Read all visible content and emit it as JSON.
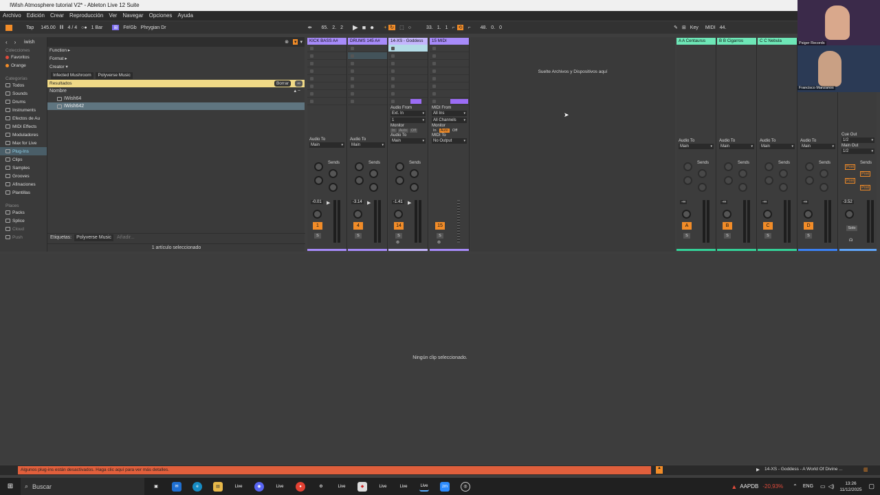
{
  "window": {
    "title": "IWish Atmosphere tutorial V2* - Ableton Live 12 Suite"
  },
  "menu": [
    "Archivo",
    "Edición",
    "Crear",
    "Reproducción",
    "Ver",
    "Navegar",
    "Opciones",
    "Ayuda"
  ],
  "transport": {
    "tap": "Tap",
    "tempo": "145.00",
    "signature": "4 / 4",
    "quant": "1 Bar",
    "key_root": "F#/Gb",
    "scale": "Phrygian Dr",
    "position": [
      "65.",
      "2.",
      "2"
    ],
    "loop_start": [
      "33.",
      "1.",
      "1"
    ],
    "loop_len": [
      "48.",
      "0.",
      "0"
    ],
    "key_label": "Key",
    "midi_label": "MIDI",
    "cpu": "44."
  },
  "browser": {
    "search_value": "iwish",
    "collections_header": "Colecciones",
    "collections": [
      {
        "label": "Favoritos",
        "color": "#e24b3b"
      },
      {
        "label": "Orange",
        "color": "#f28c28"
      }
    ],
    "categories_header": "Categorías",
    "categories": [
      "Todos",
      "Sounds",
      "Drums",
      "Instruments",
      "Efectos de Au",
      "MIDI Effects",
      "Moduladores",
      "Max for Live",
      "Plug-Ins",
      "Clips",
      "Samples",
      "Grooves",
      "Afinaciones",
      "Plantillas"
    ],
    "places_header": "Places",
    "places": [
      "Packs",
      "Splice",
      "Cloud",
      "Push"
    ],
    "filters": [
      "Function ▸",
      "Format ▸",
      "Creator ▾"
    ],
    "creator_tags": [
      "Infected Mushroom",
      "Polyverse Music"
    ],
    "results_label": "Resultados",
    "clear_button": "Borrar",
    "column_name": "Nombre",
    "results": [
      "IWish64",
      "IWish642"
    ],
    "tags_label": "Etiquetas:",
    "tag_value": "Polyverse Music",
    "tag_add": "Añadir...",
    "selection_info": "1 artículo seleccionado"
  },
  "session": {
    "drop_hint": "Suelte Archivos y Dispositivos aquí",
    "tracks": [
      {
        "name": "KICK BASS A#",
        "color": "#a78bfa",
        "audio_to": "Main",
        "vol": "-0.01",
        "num": "1"
      },
      {
        "name": "DRUMS 145 A#",
        "color": "#a78bfa",
        "audio_to": "Main",
        "vol": "-3.14",
        "num": "4"
      },
      {
        "name": "14-XS - Goddess",
        "color": "#c4b5fd",
        "audio_to": "Main",
        "vol": "-1.41",
        "num": "14",
        "audio_from": "Ext. In",
        "audio_from_ch": "1",
        "monitor": [
          "In",
          "Auto",
          "Off"
        ]
      },
      {
        "name": "15 MIDI",
        "color": "#a78bfa",
        "midi_from": "All Ins",
        "midi_ch": "All Channels",
        "monitor": [
          "In",
          "Auto",
          "Off"
        ],
        "midi_to": "No Output",
        "num": "15"
      }
    ],
    "returns": [
      {
        "name": "A A Centaurus",
        "color": "#6ee7b7",
        "audio_to": "Main",
        "vol": "-∞",
        "num": "A"
      },
      {
        "name": "B B Cigarros",
        "color": "#6ee7b7",
        "audio_to": "Main",
        "vol": "-∞",
        "num": "B"
      },
      {
        "name": "C C Nebula",
        "color": "#6ee7b7",
        "audio_to": "Main",
        "vol": "-∞",
        "num": "C"
      },
      {
        "name": "D",
        "color": "#60a5fa",
        "audio_to": "Main",
        "vol": "-∞",
        "num": "D"
      }
    ],
    "labels": {
      "audio_from": "Audio From",
      "midi_from": "MIDI From",
      "monitor": "Monitor",
      "audio_to": "Audio To",
      "midi_to": "MIDI To",
      "sends": "Sends",
      "solo": "S",
      "post": "Post"
    },
    "master": {
      "cue_out_label": "Cue Out",
      "cue_out": "1/2",
      "main_out_label": "Main Out",
      "main_out": "1/2",
      "vol": "-3.52",
      "solo": "Solo"
    }
  },
  "detail": {
    "empty_text": "Ningún clip seleccionado."
  },
  "status": {
    "warning": "Algunos plug-ins están desactivados. Haga clic aquí para ver más detalles.",
    "playing": "14-XS - Goddess - A World Of Divine ..."
  },
  "webcam": {
    "top_label": "Psiger Records",
    "bottom_label": "Francisco Manzanos"
  },
  "taskbar": {
    "search_placeholder": "Buscar",
    "stock_name": "AAPDB",
    "stock_change": "-20,93%",
    "lang": "ENG",
    "time": "13:26",
    "date": "11/12/2025"
  }
}
